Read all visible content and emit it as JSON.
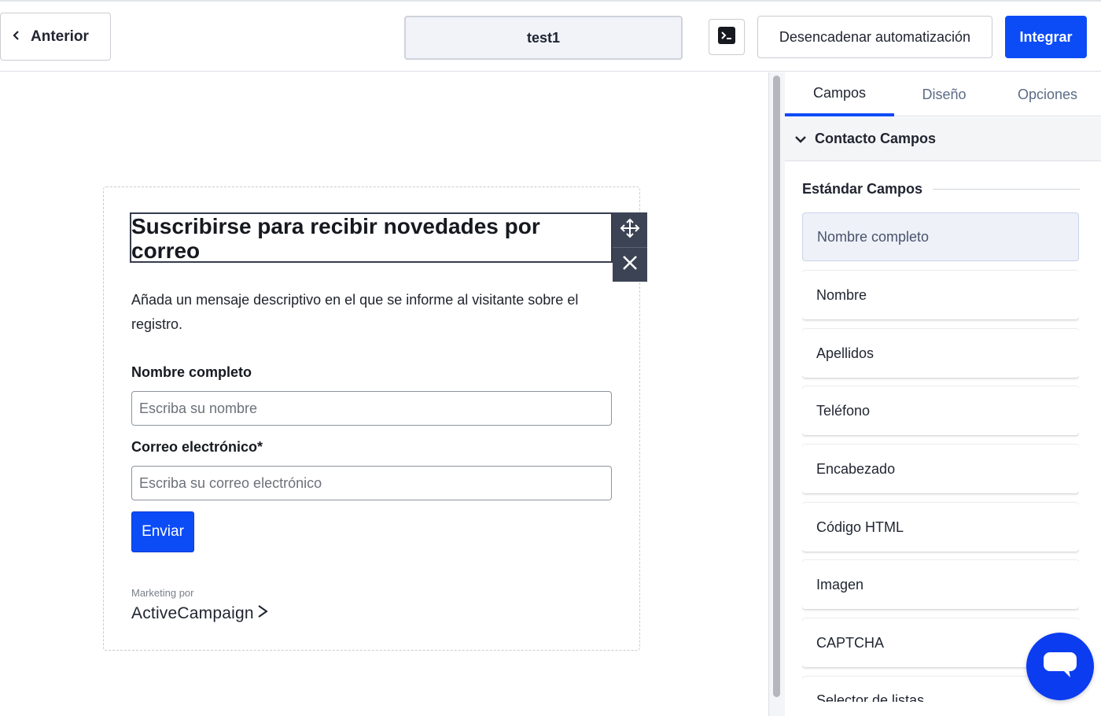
{
  "topbar": {
    "back_label": "Anterior",
    "form_title": "test1",
    "trigger_label": "Desencadenar automatización",
    "integrate_label": "Integrar"
  },
  "form": {
    "heading": "Suscribirse para recibir novedades por correo",
    "description": "Añada un mensaje descriptivo en el que se informe al visitante sobre el registro.",
    "name_label": "Nombre completo",
    "name_placeholder": "Escriba su nombre",
    "email_label": "Correo electrónico*",
    "email_placeholder": "Escriba su correo electrónico",
    "submit_label": "Enviar",
    "powered_by": "Marketing por",
    "brand": "ActiveCampaign"
  },
  "panel": {
    "tabs": [
      {
        "label": "Campos",
        "active": true
      },
      {
        "label": "Diseño",
        "active": false
      },
      {
        "label": "Opciones",
        "active": false
      }
    ],
    "section_title": "Contacto Campos",
    "subsection_title": "Estándar Campos",
    "fields": [
      {
        "label": "Nombre completo",
        "highlight": true
      },
      {
        "label": "Nombre",
        "highlight": false
      },
      {
        "label": "Apellidos",
        "highlight": false
      },
      {
        "label": "Teléfono",
        "highlight": false
      },
      {
        "label": "Encabezado",
        "highlight": false
      },
      {
        "label": "Código HTML",
        "highlight": false
      },
      {
        "label": "Imagen",
        "highlight": false
      },
      {
        "label": "CAPTCHA",
        "highlight": false
      },
      {
        "label": "Selector de listas",
        "highlight": false
      }
    ]
  },
  "colors": {
    "accent": "#0c4cf7",
    "toolbar_dark": "#3c4354"
  },
  "icons": {
    "back": "chevron-left-icon",
    "terminal": "terminal-icon",
    "move": "move-icon",
    "close": "close-icon",
    "section": "chevron-down-icon",
    "chat": "chat-icon"
  }
}
